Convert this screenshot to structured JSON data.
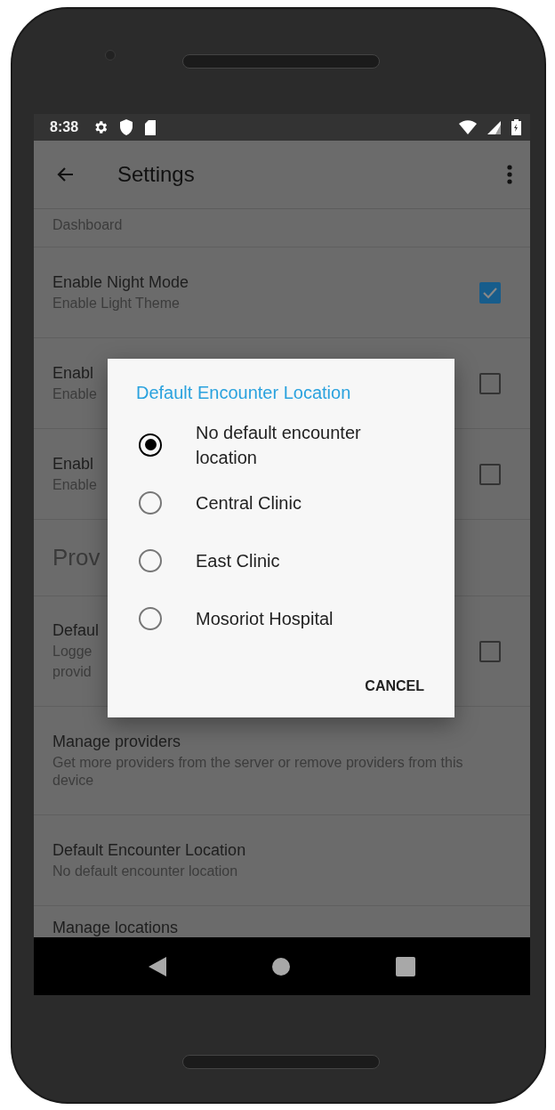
{
  "status_bar": {
    "time": "8:38"
  },
  "toolbar": {
    "title": "Settings"
  },
  "rows": [
    {
      "kind": "subtitle_only",
      "subtitle": "Dashboard"
    },
    {
      "kind": "checkbox",
      "title": "Enable Night Mode",
      "subtitle": "Enable Light Theme",
      "checked": true
    },
    {
      "kind": "checkbox",
      "title": "Enabl",
      "subtitle": "Enable",
      "checked": false
    },
    {
      "kind": "checkbox",
      "title": "Enabl",
      "subtitle": "Enable",
      "checked": false
    },
    {
      "kind": "section",
      "title": "Prov"
    },
    {
      "kind": "checkbox",
      "title": "Defaul",
      "subtitle": [
        "Logge",
        "provid"
      ],
      "checked": false
    },
    {
      "kind": "plain",
      "title": "Manage providers",
      "subtitle": "Get more providers from the server or remove providers from this device"
    },
    {
      "kind": "plain",
      "title": "Default Encounter Location",
      "subtitle": "No default encounter location"
    },
    {
      "kind": "cut",
      "title": "Manage locations"
    }
  ],
  "dialog": {
    "title": "Default Encounter Location",
    "options": [
      {
        "label": "No default encounter location",
        "selected": true
      },
      {
        "label": "Central Clinic",
        "selected": false
      },
      {
        "label": "East Clinic",
        "selected": false
      },
      {
        "label": "Mosoriot Hospital",
        "selected": false
      }
    ],
    "buttons": [
      "CANCEL"
    ]
  }
}
